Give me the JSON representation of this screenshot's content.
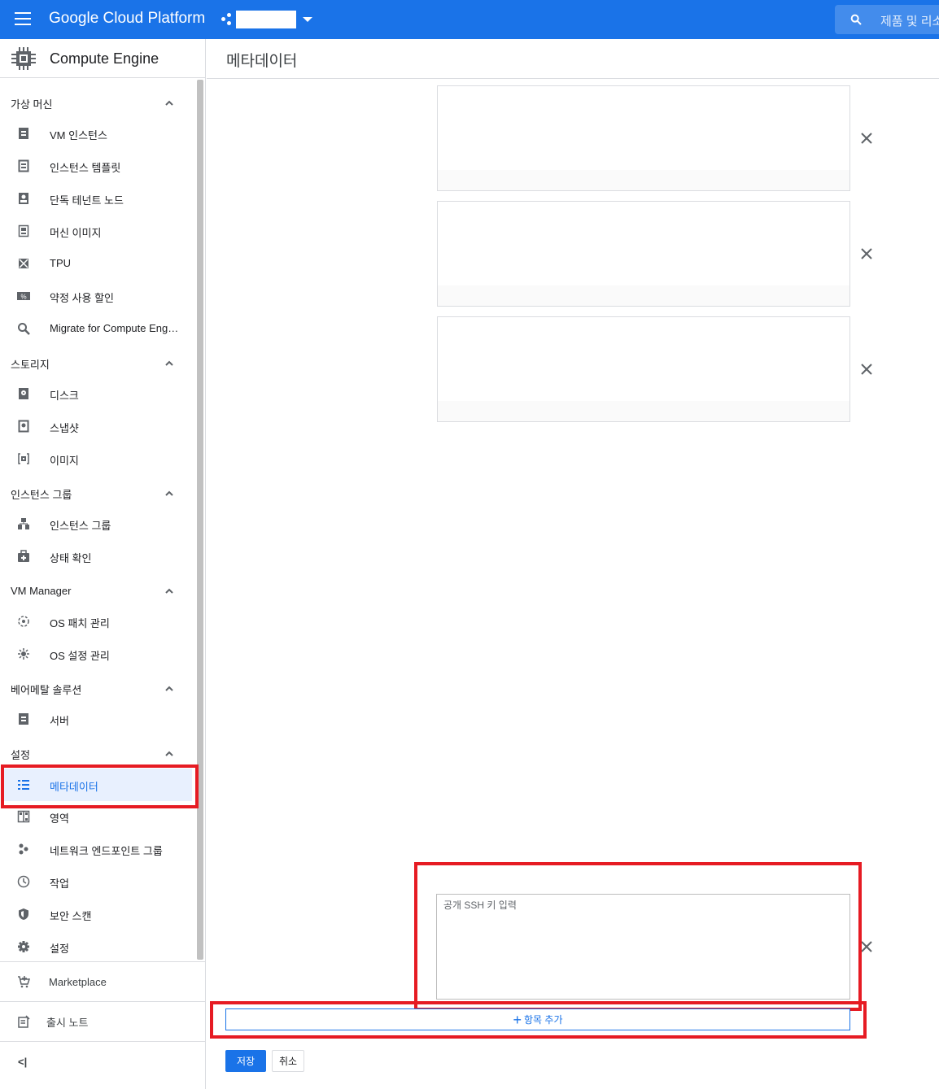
{
  "topbar": {
    "brand": "Google Cloud Platform",
    "search_placeholder": "제품 및 리소스 검색",
    "color": "#1a73e8"
  },
  "sidebar": {
    "product_title": "Compute Engine",
    "sections": [
      {
        "title": "가상 머신",
        "items": [
          {
            "label": "VM 인스턴스",
            "icon": "vm-instance-icon"
          },
          {
            "label": "인스턴스 템플릿",
            "icon": "instance-template-icon"
          },
          {
            "label": "단독 테넌트 노드",
            "icon": "sole-tenant-icon"
          },
          {
            "label": "머신 이미지",
            "icon": "machine-image-icon"
          },
          {
            "label": "TPU",
            "icon": "tpu-icon"
          },
          {
            "label": "약정 사용 할인",
            "icon": "discount-icon"
          },
          {
            "label": "Migrate for Compute Engine",
            "icon": "search-icon"
          }
        ]
      },
      {
        "title": "스토리지",
        "items": [
          {
            "label": "디스크",
            "icon": "disk-icon"
          },
          {
            "label": "스냅샷",
            "icon": "snapshot-icon"
          },
          {
            "label": "이미지",
            "icon": "image-icon"
          }
        ]
      },
      {
        "title": "인스턴스 그룹",
        "items": [
          {
            "label": "인스턴스 그룹",
            "icon": "instance-group-icon"
          },
          {
            "label": "상태 확인",
            "icon": "health-check-icon"
          }
        ]
      },
      {
        "title": "VM Manager",
        "items": [
          {
            "label": "OS 패치 관리",
            "icon": "patch-icon"
          },
          {
            "label": "OS 설정 관리",
            "icon": "os-config-icon"
          }
        ]
      },
      {
        "title": "베어메탈 솔루션",
        "items": [
          {
            "label": "서버",
            "icon": "server-icon"
          }
        ]
      },
      {
        "title": "설정",
        "items": [
          {
            "label": "메타데이터",
            "icon": "metadata-icon",
            "active": true
          },
          {
            "label": "영역",
            "icon": "zone-icon"
          },
          {
            "label": "네트워크 엔드포인트 그룹",
            "icon": "network-endpoint-icon"
          },
          {
            "label": "작업",
            "icon": "clock-icon"
          },
          {
            "label": "보안 스캔",
            "icon": "shield-icon"
          },
          {
            "label": "설정",
            "icon": "gear-icon"
          }
        ]
      }
    ],
    "marketplace": "Marketplace",
    "release_notes": "출시 노트",
    "collapse": "<|"
  },
  "main": {
    "title": "메타데이터",
    "ssh_placeholder": "공개 SSH 키 입력",
    "add_item": "항목 추가",
    "save": "저장",
    "cancel": "취소"
  }
}
